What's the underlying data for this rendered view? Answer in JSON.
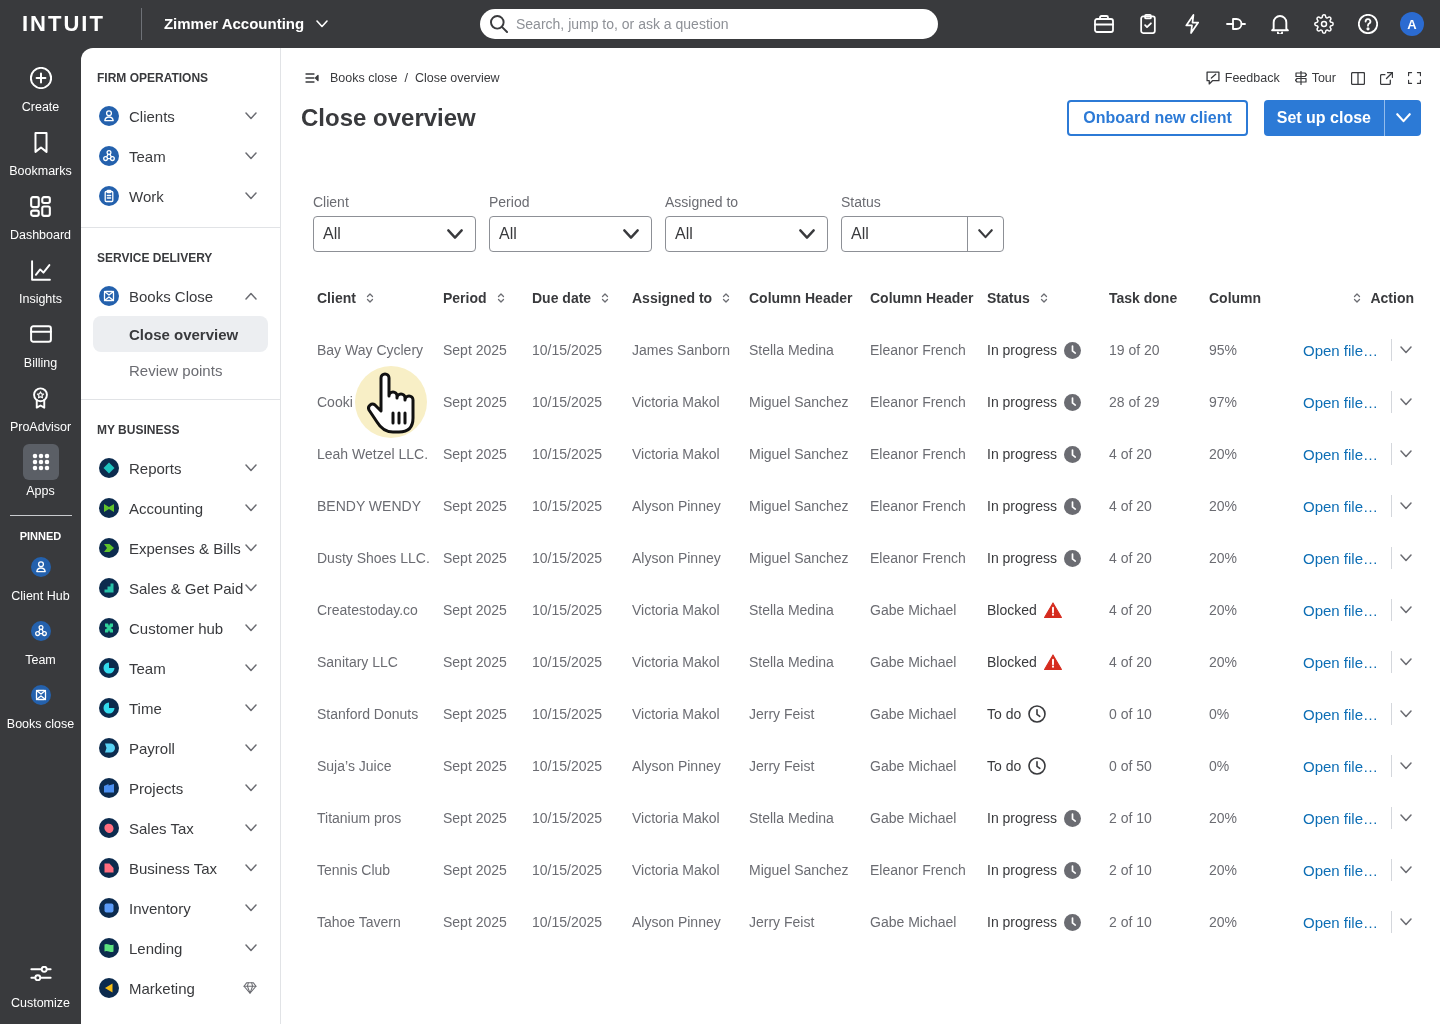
{
  "top_bar": {
    "logo": "INTUIT",
    "company": "Zimmer Accounting",
    "search": {
      "placeholder": "Search, jump to, or ask a question"
    },
    "avatar": "A"
  },
  "rail": {
    "items": [
      {
        "label": "Create",
        "selected": false
      },
      {
        "label": "Bookmarks",
        "selected": false
      },
      {
        "label": "Dashboard",
        "selected": false
      },
      {
        "label": "Insights",
        "selected": false
      },
      {
        "label": "Billing",
        "selected": false
      },
      {
        "label": "ProAdvisor",
        "selected": false
      },
      {
        "label": "Apps",
        "selected": true
      }
    ],
    "pinned_title": "PINNED",
    "pinned": [
      {
        "label": "Client Hub"
      },
      {
        "label": "Team"
      },
      {
        "label": "Books close"
      }
    ],
    "customize": "Customize"
  },
  "sidebar": {
    "sections": [
      {
        "title": "FIRM OPERATIONS",
        "items": [
          {
            "label": "Clients",
            "expanded": false
          },
          {
            "label": "Team",
            "expanded": false
          },
          {
            "label": "Work",
            "expanded": false
          }
        ]
      },
      {
        "title": "SERVICE DELIVERY",
        "items": [
          {
            "label": "Books Close",
            "expanded": true,
            "children": [
              {
                "label": "Close overview",
                "selected": true
              },
              {
                "label": "Review points",
                "selected": false
              }
            ]
          }
        ]
      },
      {
        "title": "MY BUSINESS",
        "items": [
          {
            "label": "Reports",
            "expanded": false,
            "premium": false
          },
          {
            "label": "Accounting",
            "expanded": false,
            "premium": false
          },
          {
            "label": "Expenses & Bills",
            "expanded": false,
            "premium": false
          },
          {
            "label": "Sales & Get Paid",
            "expanded": false,
            "premium": false
          },
          {
            "label": "Customer hub",
            "expanded": false,
            "premium": false
          },
          {
            "label": "Team",
            "expanded": false,
            "premium": false
          },
          {
            "label": "Time",
            "expanded": false,
            "premium": false
          },
          {
            "label": "Payroll",
            "expanded": false,
            "premium": false
          },
          {
            "label": "Projects",
            "expanded": false,
            "premium": false
          },
          {
            "label": "Sales Tax",
            "expanded": false,
            "premium": false
          },
          {
            "label": "Business Tax",
            "expanded": false,
            "premium": false
          },
          {
            "label": "Inventory",
            "expanded": false,
            "premium": false
          },
          {
            "label": "Lending",
            "expanded": false,
            "premium": false
          },
          {
            "label": "Marketing",
            "premium": true
          }
        ]
      }
    ]
  },
  "breadcrumb": {
    "items": [
      "Books close",
      "Close overview"
    ],
    "separator": "/"
  },
  "tools": [
    {
      "label": "Feedback"
    },
    {
      "label": "Tour"
    }
  ],
  "title": "Close overview",
  "actions": {
    "secondary": "Onboard new client",
    "primary": "Set up close"
  },
  "filters": [
    {
      "label": "Client",
      "value": "All",
      "kind": "plain"
    },
    {
      "label": "Period",
      "value": "All",
      "kind": "plain"
    },
    {
      "label": "Assigned to",
      "value": "All",
      "kind": "plain"
    },
    {
      "label": "Status",
      "value": "All",
      "kind": "split"
    }
  ],
  "table": {
    "columns": [
      {
        "label": "Client",
        "sortable": true
      },
      {
        "label": "Period",
        "sortable": true
      },
      {
        "label": "Due date",
        "sortable": true
      },
      {
        "label": "Assigned to",
        "sortable": true
      },
      {
        "label": "Column Header",
        "sortable": false
      },
      {
        "label": "Column Header",
        "sortable": false
      },
      {
        "label": "Status",
        "sortable": true
      },
      {
        "label": "Task done",
        "sortable": false
      },
      {
        "label": "Column",
        "sortable": false
      },
      {
        "label": "Action",
        "sortable": true
      }
    ],
    "rows": [
      {
        "client": "Bay Way Cyclery",
        "period": "Sept 2025",
        "due_date": "10/15/2025",
        "assigned_to": "James Sanborn",
        "column_5": "Stella Medina",
        "column_6": "Eleanor French",
        "status": {
          "label": "In progress",
          "kind": "in_progress"
        },
        "task_done": "19 of 20",
        "column_9": "95%",
        "action": "Open file…",
        "hovered": false
      },
      {
        "client": "Cooki",
        "period": "Sept 2025",
        "due_date": "10/15/2025",
        "assigned_to": "Victoria Makol",
        "column_5": "Miguel Sanchez",
        "column_6": "Eleanor French",
        "status": {
          "label": "In progress",
          "kind": "in_progress"
        },
        "task_done": "28 of 29",
        "column_9": "97%",
        "action": "Open file…",
        "hovered": true
      },
      {
        "client": "Leah Wetzel LLC.",
        "period": "Sept 2025",
        "due_date": "10/15/2025",
        "assigned_to": "Victoria Makol",
        "column_5": "Miguel Sanchez",
        "column_6": "Eleanor French",
        "status": {
          "label": "In progress",
          "kind": "in_progress"
        },
        "task_done": "4 of 20",
        "column_9": "20%",
        "action": "Open file…",
        "hovered": false
      },
      {
        "client": "BENDY WENDY",
        "period": "Sept 2025",
        "due_date": "10/15/2025",
        "assigned_to": "Alyson Pinney",
        "column_5": "Miguel Sanchez",
        "column_6": "Eleanor French",
        "status": {
          "label": "In progress",
          "kind": "in_progress"
        },
        "task_done": "4 of 20",
        "column_9": "20%",
        "action": "Open file…",
        "hovered": false
      },
      {
        "client": "Dusty Shoes LLC.",
        "period": "Sept 2025",
        "due_date": "10/15/2025",
        "assigned_to": "Alyson Pinney",
        "column_5": "Miguel Sanchez",
        "column_6": "Eleanor French",
        "status": {
          "label": "In progress",
          "kind": "in_progress"
        },
        "task_done": "4 of 20",
        "column_9": "20%",
        "action": "Open file…",
        "hovered": false
      },
      {
        "client": "Createstoday.co",
        "period": "Sept 2025",
        "due_date": "10/15/2025",
        "assigned_to": "Victoria Makol",
        "column_5": "Stella Medina",
        "column_6": "Gabe Michael",
        "status": {
          "label": "Blocked",
          "kind": "blocked"
        },
        "task_done": "4 of 20",
        "column_9": "20%",
        "action": "Open file…",
        "hovered": false
      },
      {
        "client": "Sanitary LLC",
        "period": "Sept 2025",
        "due_date": "10/15/2025",
        "assigned_to": "Victoria Makol",
        "column_5": "Stella Medina",
        "column_6": "Gabe Michael",
        "status": {
          "label": "Blocked",
          "kind": "blocked"
        },
        "task_done": "4 of 20",
        "column_9": "20%",
        "action": "Open file…",
        "hovered": false
      },
      {
        "client": "Stanford Donuts",
        "period": "Sept 2025",
        "due_date": "10/15/2025",
        "assigned_to": "Victoria Makol",
        "column_5": "Jerry Feist",
        "column_6": "Gabe Michael",
        "status": {
          "label": "To do",
          "kind": "todo"
        },
        "task_done": "0 of 10",
        "column_9": "0%",
        "action": "Open file…",
        "hovered": false
      },
      {
        "client": "Suja’s Juice",
        "period": "Sept 2025",
        "due_date": "10/15/2025",
        "assigned_to": "Alyson Pinney",
        "column_5": "Jerry Feist",
        "column_6": "Gabe Michael",
        "status": {
          "label": "To do",
          "kind": "todo"
        },
        "task_done": "0 of 50",
        "column_9": "0%",
        "action": "Open file…",
        "hovered": false
      },
      {
        "client": "Titanium pros",
        "period": "Sept 2025",
        "due_date": "10/15/2025",
        "assigned_to": "Victoria Makol",
        "column_5": "Stella Medina",
        "column_6": "Gabe Michael",
        "status": {
          "label": "In progress",
          "kind": "in_progress"
        },
        "task_done": "2 of 10",
        "column_9": "20%",
        "action": "Open file…",
        "hovered": false
      },
      {
        "client": "Tennis Club",
        "period": "Sept 2025",
        "due_date": "10/15/2025",
        "assigned_to": "Victoria Makol",
        "column_5": "Miguel Sanchez",
        "column_6": "Eleanor French",
        "status": {
          "label": "In progress",
          "kind": "in_progress"
        },
        "task_done": "2 of 10",
        "column_9": "20%",
        "action": "Open file…",
        "hovered": false
      },
      {
        "client": "Tahoe Tavern",
        "period": "Sept 2025",
        "due_date": "10/15/2025",
        "assigned_to": "Alyson Pinney",
        "column_5": "Jerry Feist",
        "column_6": "Gabe Michael",
        "status": {
          "label": "In progress",
          "kind": "in_progress"
        },
        "task_done": "2 of 10",
        "column_9": "20%",
        "action": "Open file…",
        "hovered": false
      }
    ]
  }
}
